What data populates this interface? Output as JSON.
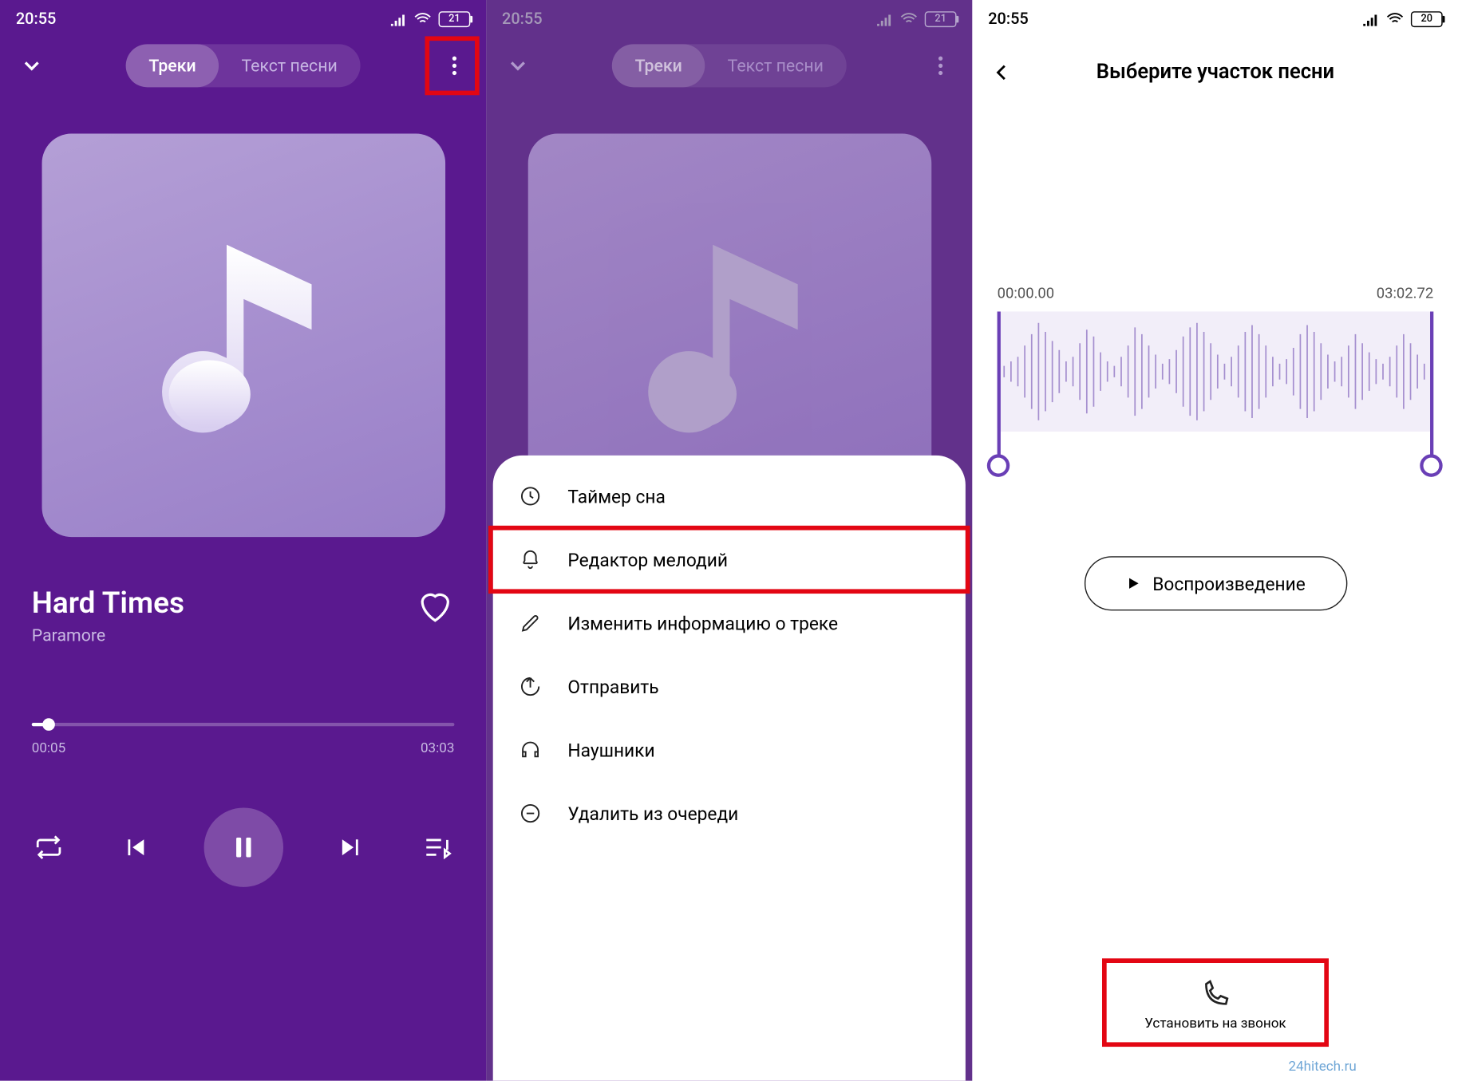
{
  "status": {
    "time": "20:55",
    "battery_1": "21",
    "battery_3": "20"
  },
  "tabs": {
    "tracks": "Треки",
    "lyrics": "Текст песни"
  },
  "track": {
    "title": "Hard Times",
    "artist": "Paramore"
  },
  "progress": {
    "elapsed": "00:05",
    "total": "03:03"
  },
  "menu": {
    "sleep_timer": "Таймер сна",
    "ringtone_editor": "Редактор мелодий",
    "edit_info": "Изменить информацию о треке",
    "share": "Отправить",
    "headphones": "Наушники",
    "remove_queue": "Удалить из очереди"
  },
  "editor": {
    "title": "Выберите участок песни",
    "start": "00:00.00",
    "end": "03:02.72",
    "play": "Воспроизведение",
    "set_ringtone": "Установить на звонок"
  },
  "watermark": "24hitech.ru"
}
